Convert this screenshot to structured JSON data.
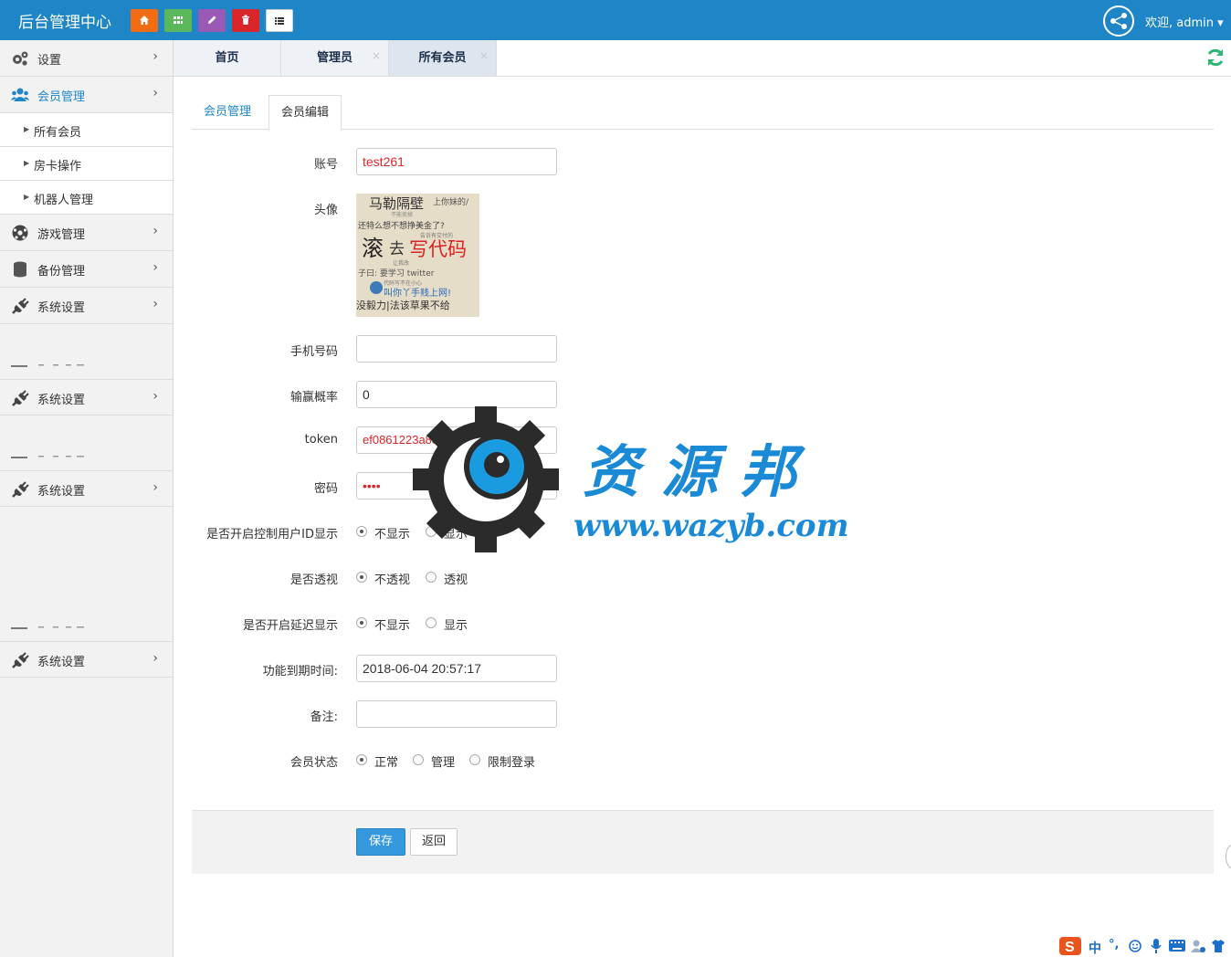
{
  "header": {
    "brand": "后台管理中心",
    "quick_buttons": [
      {
        "name": "home",
        "color": "#f26c14",
        "glyph": "⌂"
      },
      {
        "name": "grid",
        "color": "#5bb75b",
        "glyph": "▦"
      },
      {
        "name": "edit",
        "color": "#9b59b6",
        "glyph": "✎"
      },
      {
        "name": "delete",
        "color": "#d9262a",
        "glyph": "🗑"
      },
      {
        "name": "list",
        "color": "#ffffff",
        "glyph": "≡"
      }
    ],
    "welcome": "欢迎, admin ▾"
  },
  "sidebar": {
    "items": [
      {
        "label": "设置",
        "icon": "gears-icon",
        "chev": "›"
      },
      {
        "label": "会员管理",
        "icon": "users-icon",
        "chev": "›"
      },
      {
        "label": "游戏管理",
        "icon": "soccer-ball-icon",
        "chev": "›"
      },
      {
        "label": "备份管理",
        "icon": "database-icon",
        "chev": "›"
      },
      {
        "label": "系统设置",
        "icon": "plug-icon",
        "chev": "›"
      },
      {
        "label": "系统设置",
        "icon": "plug-icon",
        "chev": "›"
      },
      {
        "label": "系统设置",
        "icon": "plug-icon",
        "chev": "›"
      },
      {
        "label": "系统设置",
        "icon": "plug-icon",
        "chev": "›"
      }
    ],
    "sub_items": [
      {
        "label": "所有会员"
      },
      {
        "label": "房卡操作"
      },
      {
        "label": "机器人管理"
      }
    ]
  },
  "page_tabs": [
    {
      "label": "首页",
      "close": ""
    },
    {
      "label": "管理员",
      "close": "×"
    },
    {
      "label": "所有会员",
      "close": "×"
    }
  ],
  "inner_tabs": [
    "会员管理",
    "会员编辑"
  ],
  "form": {
    "account_label": "账号",
    "account_value": "test261",
    "avatar_label": "头像",
    "phone_label": "手机号码",
    "phone_value": "",
    "winrate_label": "输赢概率",
    "winrate_value": "0",
    "token_label": "token",
    "token_value": "ef0861223a85c8bc95a2ac26e2",
    "password_label": "密码",
    "password_value": "••••",
    "show_id_label": "是否开启控制用户ID显示",
    "show_id_options": [
      "不显示",
      "显示"
    ],
    "see_through_label": "是否透视",
    "see_through_options": [
      "不透视",
      "透视"
    ],
    "delay_label": "是否开启延迟显示",
    "delay_options": [
      "不显示",
      "显示"
    ],
    "expire_label": "功能到期时间:",
    "expire_value": "2018-06-04 20:57:17",
    "remark_label": "备注:",
    "remark_value": "",
    "status_label": "会员状态",
    "status_options": [
      "正常",
      "管理",
      "限制登录"
    ],
    "save": "保存",
    "back": "返回"
  },
  "avatar_text": {
    "l1": "马勒隔壁",
    "l1b": "上你妹的/",
    "l2": "还特么想不想挣美金了?",
    "l3a": "滚",
    "l3b": "去",
    "l3c": "写代码",
    "l4": "子曰: 要学习 twitter",
    "l5": "叫你丫手贱上网!",
    "l6": "没毅力|法该草果不给"
  },
  "watermark": {
    "title": "资源邦",
    "url": "www.wazyb.com"
  },
  "ime": {
    "lang": "中",
    "punct": "°,"
  },
  "colors": {
    "header_bg": "#1e86c7",
    "accent": "#1e86c7",
    "save_button": "#3598dc",
    "sidebar_bg": "#f2f2f2",
    "refresh": "#2bb673"
  }
}
